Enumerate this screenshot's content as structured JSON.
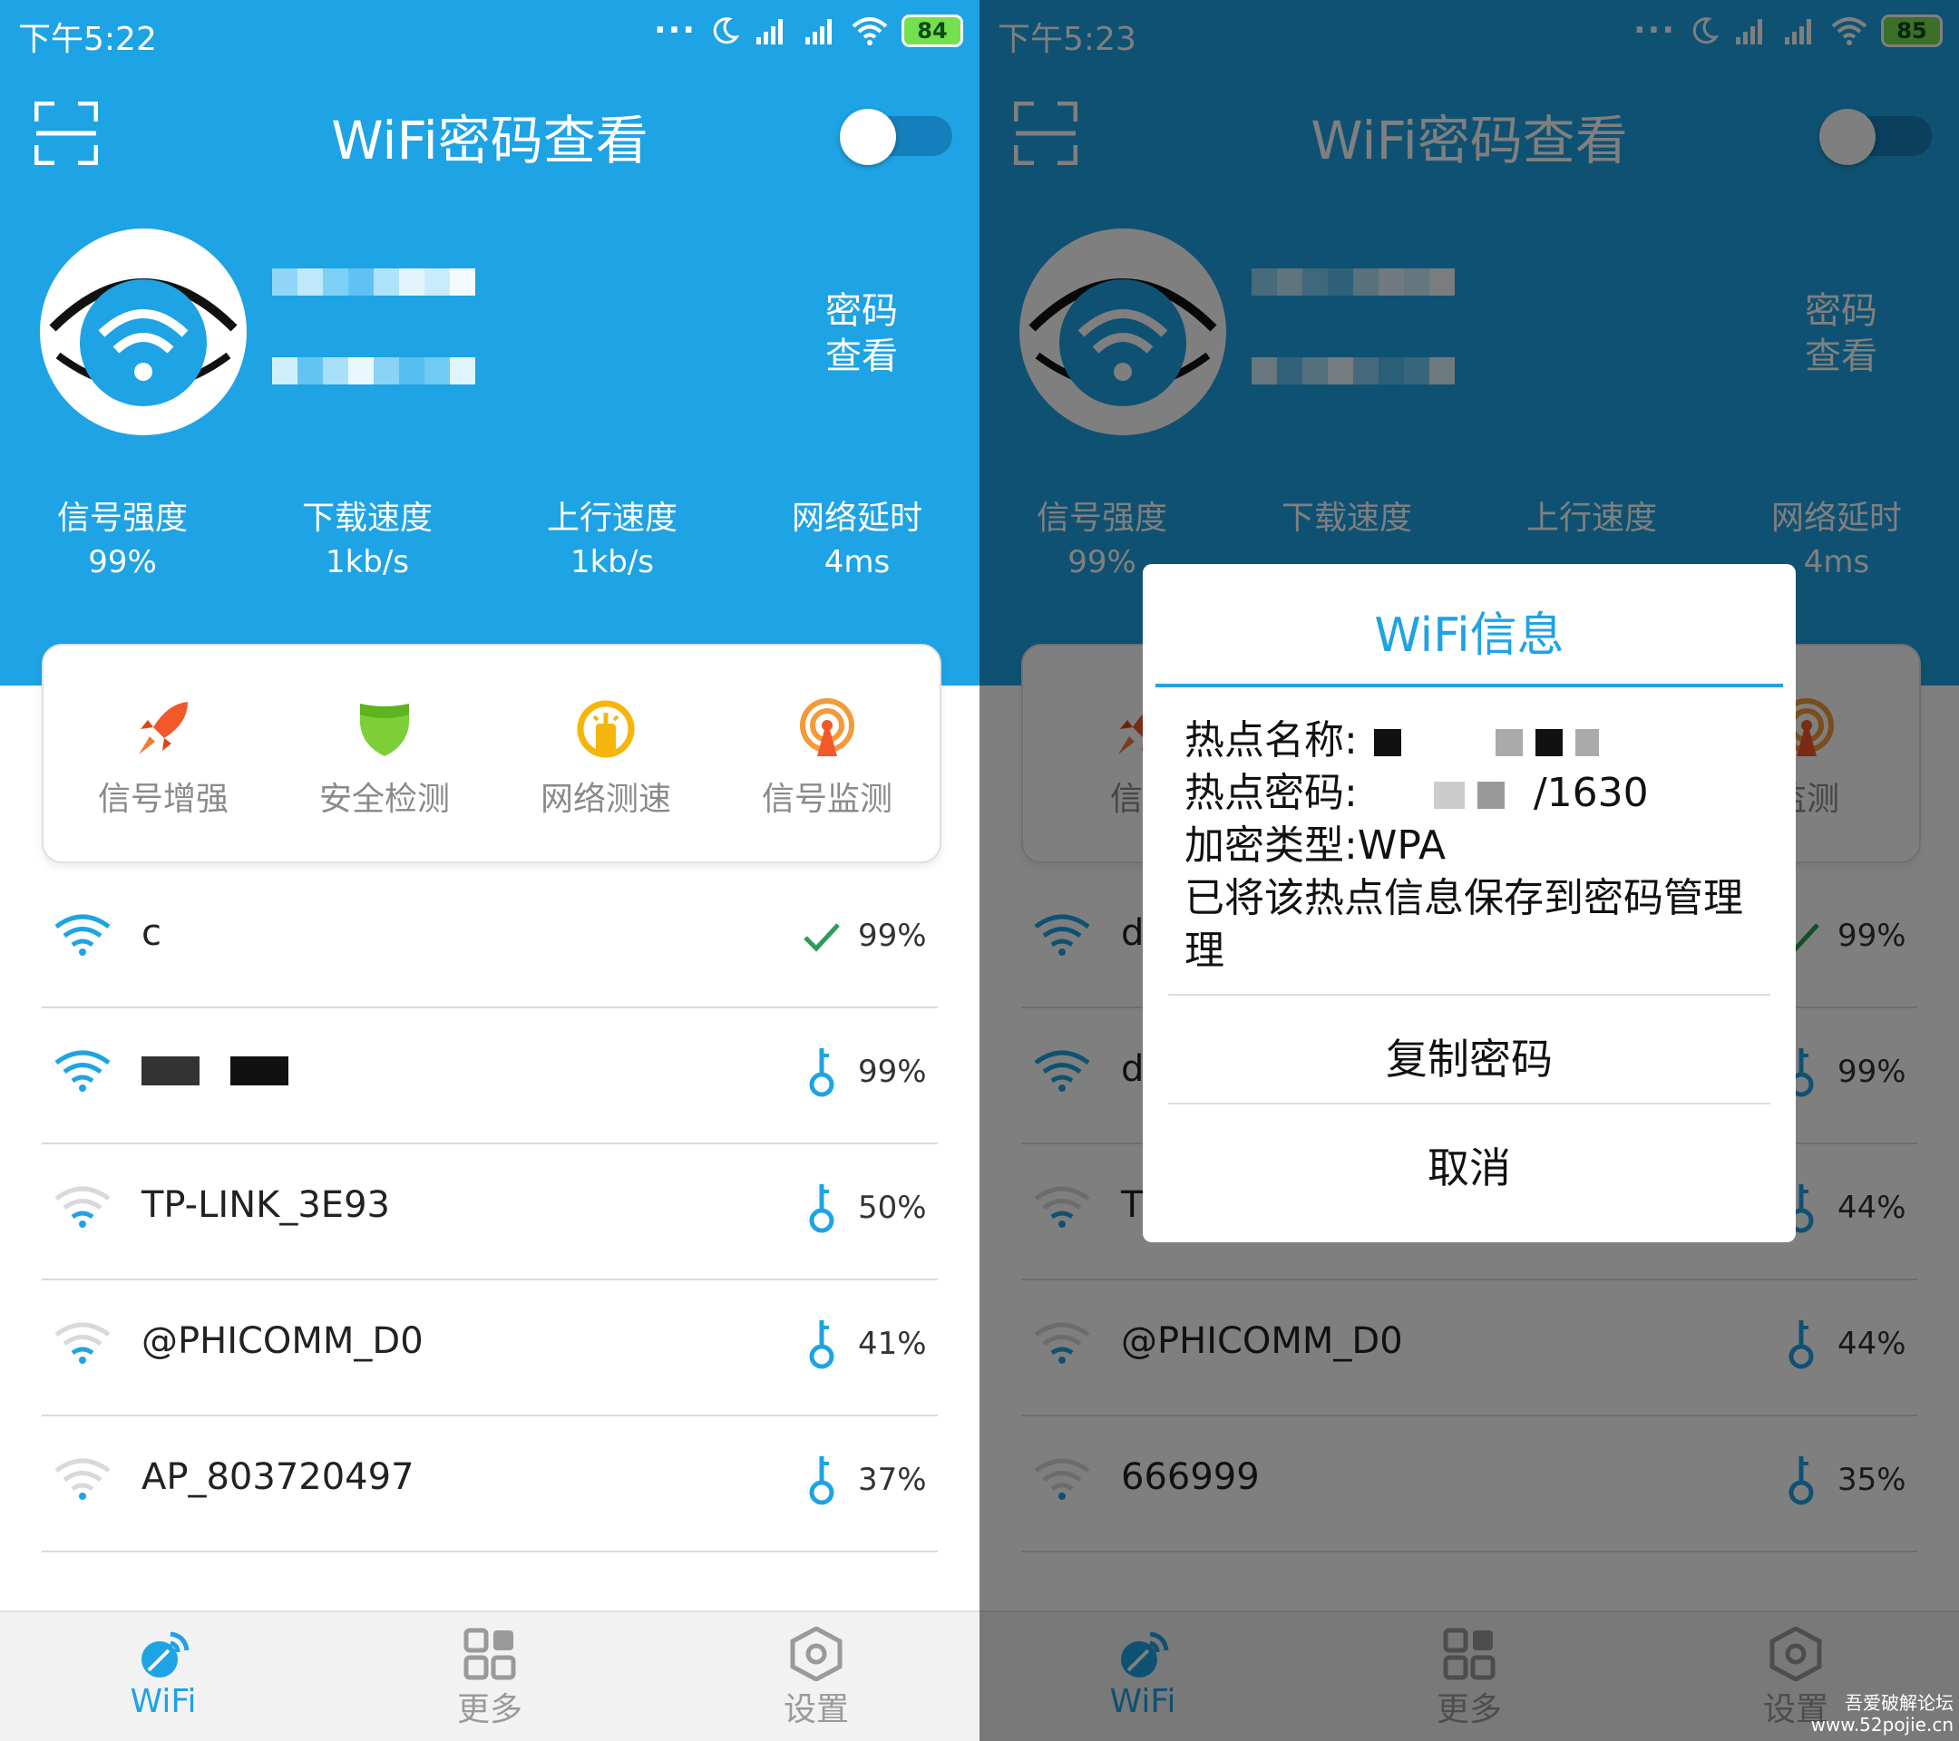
{
  "colors": {
    "accent": "#1ea3e4",
    "header_bg": "#1ea3e4",
    "check": "#2a9d5a"
  },
  "screens": [
    {
      "status": {
        "time": "下午5:22",
        "battery": "84"
      },
      "title": "WiFi密码查看",
      "password_view_button": "密码查看",
      "stats": [
        {
          "label": "信号强度",
          "value": "99%"
        },
        {
          "label": "下载速度",
          "value": "1kb/s"
        },
        {
          "label": "上行速度",
          "value": "1kb/s"
        },
        {
          "label": "网络延时",
          "value": "4ms"
        }
      ],
      "tools": [
        {
          "label": "信号增强",
          "icon": "rocket-icon"
        },
        {
          "label": "安全检测",
          "icon": "shield-icon"
        },
        {
          "label": "网络测速",
          "icon": "speedometer-icon"
        },
        {
          "label": "信号监测",
          "icon": "signal-tower-icon"
        }
      ],
      "networks": [
        {
          "name": "c",
          "signal": "99%",
          "status": "connected"
        },
        {
          "name": "",
          "signal": "99%",
          "status": "key"
        },
        {
          "name": "TP-LINK_3E93",
          "signal": "50%",
          "status": "key"
        },
        {
          "name": "@PHICOMM_D0",
          "signal": "41%",
          "status": "key"
        },
        {
          "name": "AP_803720497",
          "signal": "37%",
          "status": "key"
        }
      ],
      "nav": [
        {
          "label": "WiFi",
          "active": true
        },
        {
          "label": "更多",
          "active": false
        },
        {
          "label": "设置",
          "active": false
        }
      ]
    },
    {
      "status": {
        "time": "下午5:23",
        "battery": "85"
      },
      "title": "WiFi密码查看",
      "password_view_button": "密码查看",
      "stats": [
        {
          "label": "信号强度",
          "value": "99%"
        },
        {
          "label": "下载速度",
          "value": ""
        },
        {
          "label": "上行速度",
          "value": ""
        },
        {
          "label": "网络延时",
          "value": "4ms"
        }
      ],
      "tools": [
        {
          "label": "信号",
          "icon": "rocket-icon"
        },
        {
          "label": "监测",
          "icon": "signal-tower-icon"
        }
      ],
      "networks": [
        {
          "name": "d",
          "signal": "99%",
          "status": "connected"
        },
        {
          "name": "d",
          "signal": "99%",
          "status": "key"
        },
        {
          "name": "T",
          "signal": "44%",
          "status": "key"
        },
        {
          "name": "@PHICOMM_D0",
          "signal": "44%",
          "status": "key"
        },
        {
          "name": "666999",
          "signal": "35%",
          "status": "key"
        }
      ],
      "nav": [
        {
          "label": "WiFi",
          "active": true
        },
        {
          "label": "更多",
          "active": false
        },
        {
          "label": "设置",
          "active": false
        }
      ],
      "dialog": {
        "title": "WiFi信息",
        "hotspot_name_label": "热点名称:",
        "hotspot_password_label": "热点密码:",
        "hotspot_password_tail": "/1630",
        "encryption": "加密类型:WPA",
        "saved_message": "已将该热点信息保存到密码管理",
        "saved_message_cont": "理",
        "copy_button": "复制密码",
        "cancel_button": "取消"
      }
    }
  ],
  "watermark": {
    "line1": "吾爱破解论坛",
    "line2": "www.52pojie.cn"
  }
}
